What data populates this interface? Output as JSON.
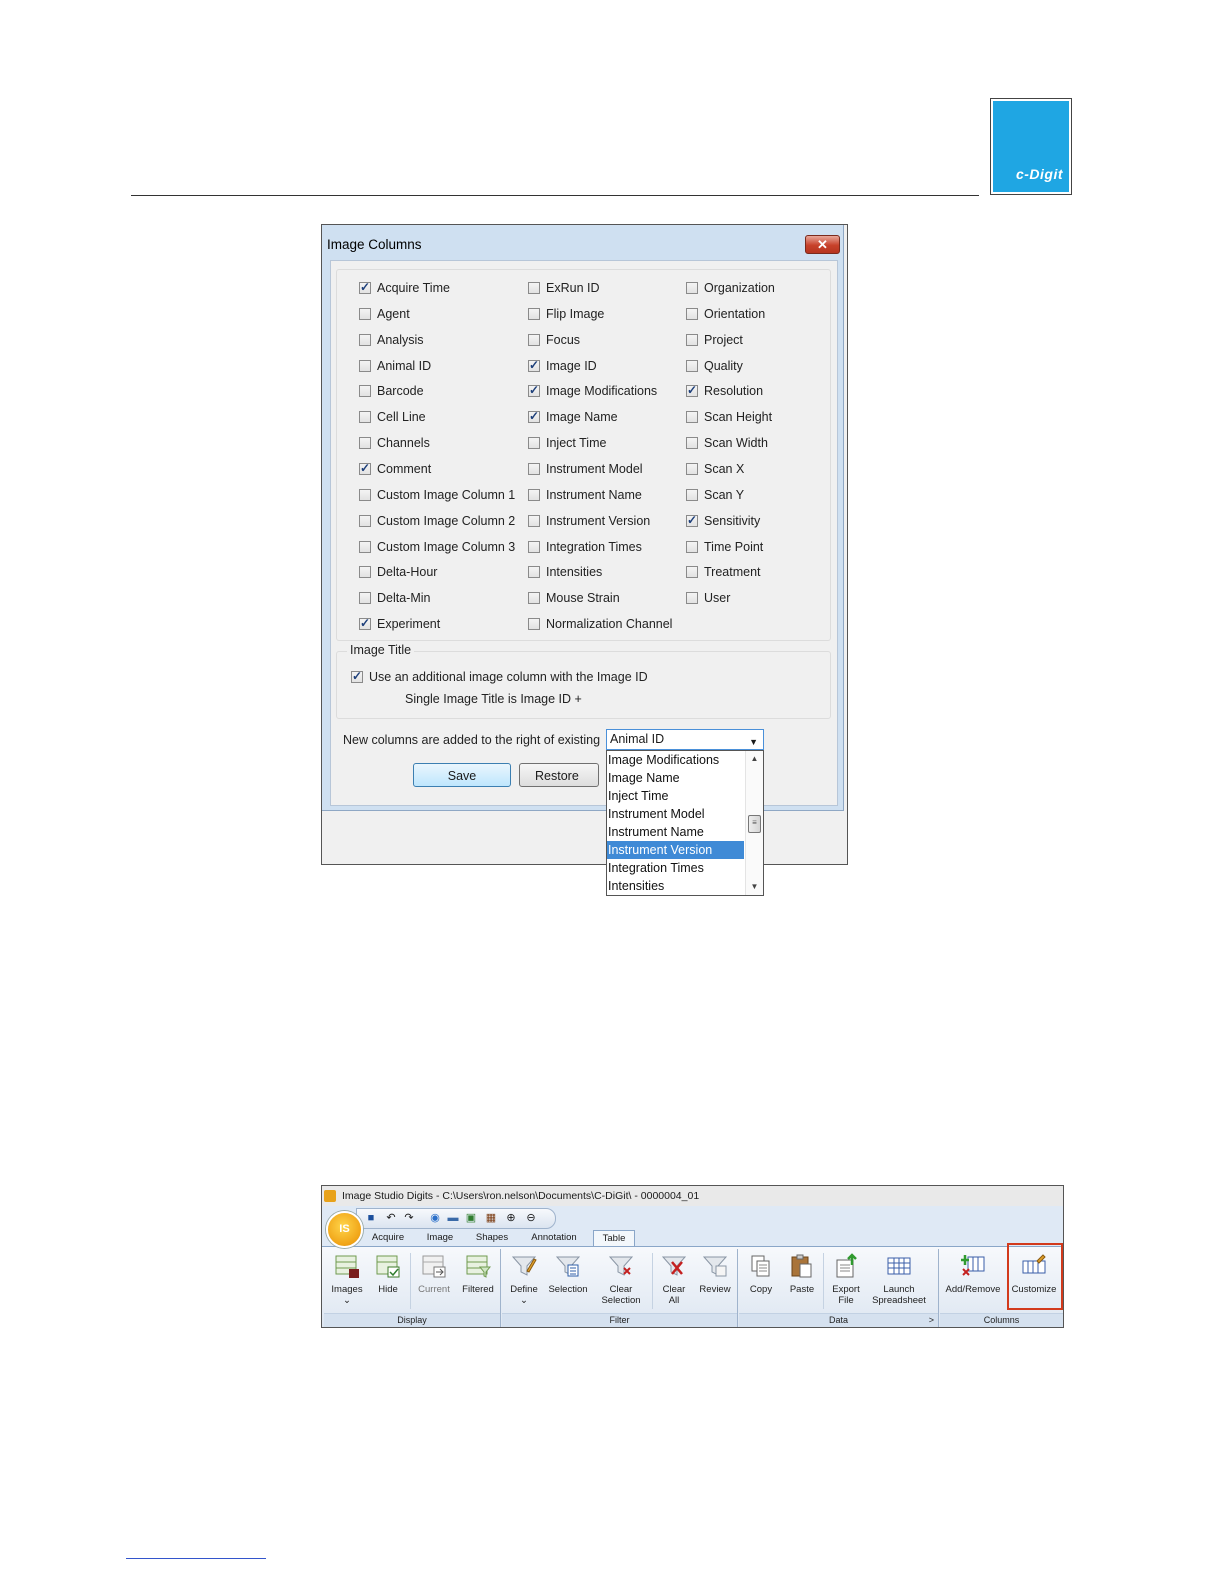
{
  "header": {
    "logo_text": "c-Digit"
  },
  "dialog": {
    "title": "Image Columns",
    "close_label": "✕",
    "columns": [
      [
        {
          "label": "Acquire Time",
          "checked": true
        },
        {
          "label": "Agent",
          "checked": false
        },
        {
          "label": "Analysis",
          "checked": false
        },
        {
          "label": "Animal ID",
          "checked": false
        },
        {
          "label": "Barcode",
          "checked": false
        },
        {
          "label": "Cell Line",
          "checked": false
        },
        {
          "label": "Channels",
          "checked": false
        },
        {
          "label": "Comment",
          "checked": true
        },
        {
          "label": "Custom Image Column 1",
          "checked": false
        },
        {
          "label": "Custom Image Column 2",
          "checked": false
        },
        {
          "label": "Custom Image Column 3",
          "checked": false
        },
        {
          "label": "Delta-Hour",
          "checked": false
        },
        {
          "label": "Delta-Min",
          "checked": false
        },
        {
          "label": "Experiment",
          "checked": true
        }
      ],
      [
        {
          "label": "ExRun ID",
          "checked": false
        },
        {
          "label": "Flip Image",
          "checked": false
        },
        {
          "label": "Focus",
          "checked": false
        },
        {
          "label": "Image ID",
          "checked": true
        },
        {
          "label": "Image Modifications",
          "checked": true
        },
        {
          "label": "Image Name",
          "checked": true
        },
        {
          "label": "Inject Time",
          "checked": false
        },
        {
          "label": "Instrument Model",
          "checked": false
        },
        {
          "label": "Instrument Name",
          "checked": false
        },
        {
          "label": "Instrument Version",
          "checked": false
        },
        {
          "label": "Integration Times",
          "checked": false
        },
        {
          "label": "Intensities",
          "checked": false
        },
        {
          "label": "Mouse Strain",
          "checked": false
        },
        {
          "label": "Normalization Channel",
          "checked": false
        }
      ],
      [
        {
          "label": "Organization",
          "checked": false
        },
        {
          "label": "Orientation",
          "checked": false
        },
        {
          "label": "Project",
          "checked": false
        },
        {
          "label": "Quality",
          "checked": false
        },
        {
          "label": "Resolution",
          "checked": true
        },
        {
          "label": "Scan Height",
          "checked": false
        },
        {
          "label": "Scan Width",
          "checked": false
        },
        {
          "label": "Scan X",
          "checked": false
        },
        {
          "label": "Scan Y",
          "checked": false
        },
        {
          "label": "Sensitivity",
          "checked": true
        },
        {
          "label": "Time Point",
          "checked": false
        },
        {
          "label": "Treatment",
          "checked": false
        },
        {
          "label": "User",
          "checked": false
        }
      ]
    ],
    "image_title": {
      "legend": "Image Title",
      "use_additional_label": "Use an additional image column with the Image ID",
      "use_additional_checked": true,
      "single_title_label": "Single Image Title is Image ID  +",
      "select_value": "Animal ID",
      "dropdown_options": [
        "Image Modifications",
        "Image Name",
        "Inject Time",
        "Instrument Model",
        "Instrument Name",
        "Instrument Version",
        "Integration Times",
        "Intensities"
      ],
      "dropdown_selected": "Instrument Version"
    },
    "note": "New columns are added to the right of existing",
    "save_label": "Save",
    "restore_label": "Restore De"
  },
  "ribbon": {
    "window_title": "Image Studio Digits - C:\\Users\\ron.nelson\\Documents\\C-DiGit\\ - 0000004_01",
    "orb_label": "IS",
    "tabs": [
      "Acquire",
      "Image",
      "Shapes",
      "Annotation",
      "Table"
    ],
    "active_tab": "Table",
    "groups": {
      "display": {
        "label": "Display",
        "buttons": [
          {
            "line1": "Images",
            "line2": "⌄"
          },
          {
            "line1": "Hide",
            "line2": ""
          },
          {
            "line1": "Current",
            "line2": ""
          },
          {
            "line1": "Filtered",
            "line2": ""
          }
        ]
      },
      "filter": {
        "label": "Filter",
        "buttons": [
          {
            "line1": "Define",
            "line2": "⌄"
          },
          {
            "line1": "Selection",
            "line2": ""
          },
          {
            "line1": "Clear",
            "line2": "Selection"
          },
          {
            "line1": "Clear",
            "line2": "All"
          },
          {
            "line1": "Review",
            "line2": ""
          }
        ]
      },
      "data": {
        "label": "Data",
        "launcher": ">",
        "buttons": [
          {
            "line1": "Copy",
            "line2": ""
          },
          {
            "line1": "Paste",
            "line2": ""
          },
          {
            "line1": "Export",
            "line2": "File"
          },
          {
            "line1": "Launch",
            "line2": "Spreadsheet"
          }
        ]
      },
      "columns": {
        "label": "Columns",
        "buttons": [
          {
            "line1": "Add/Remove",
            "line2": ""
          },
          {
            "line1": "Customize",
            "line2": ""
          }
        ]
      }
    },
    "highlight_color": "#d23a1c"
  }
}
